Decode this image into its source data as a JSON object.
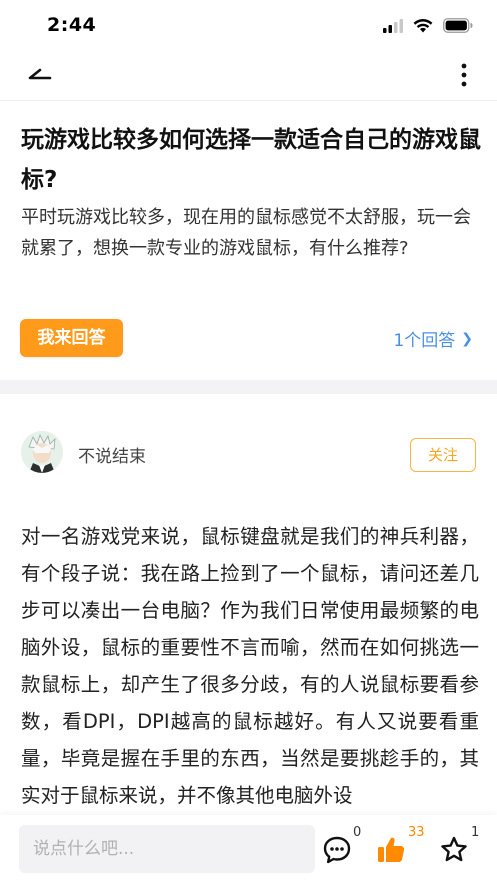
{
  "status_bar": {
    "time": "2:44"
  },
  "nav": {
    "back_icon": "back-arrow-icon",
    "more_icon": "more-vertical-icon"
  },
  "question": {
    "title": "玩游戏比较多如何选择一款适合自己的游戏鼠标?",
    "description": "平时玩游戏比较多，现在用的鼠标感觉不太舒服，玩一会就累了，想换一款专业的游戏鼠标，有什么推荐?",
    "answer_button": "我来回答",
    "answer_count": "1个回答",
    "chevron": "❯"
  },
  "author": {
    "name": "不说结束",
    "follow_label": "关注"
  },
  "article": {
    "text": "对一名游戏党来说，鼠标键盘就是我们的神兵利器，有个段子说：我在路上捡到了一个鼠标，请问还差几步可以凑出一台电脑？作为我们日常使用最频繁的电脑外设，鼠标的重要性不言而喻，然而在如何挑选一款鼠标上，却产生了很多分歧，有的人说鼠标要看参数，看DPI，DPI越高的鼠标越好。有人又说要看重量，毕竟是握在手里的东西，当然是要挑趁手的，其实对于鼠标来说，并不像其他电脑外设"
  },
  "bottom_bar": {
    "comment_placeholder": "说点什么吧...",
    "comment_count": "0",
    "like_count": "33",
    "favorite_count": "1"
  },
  "colors": {
    "accent_orange": "#ff9a1a",
    "link_blue": "#4a90e2",
    "follow_border": "#f5b544"
  }
}
